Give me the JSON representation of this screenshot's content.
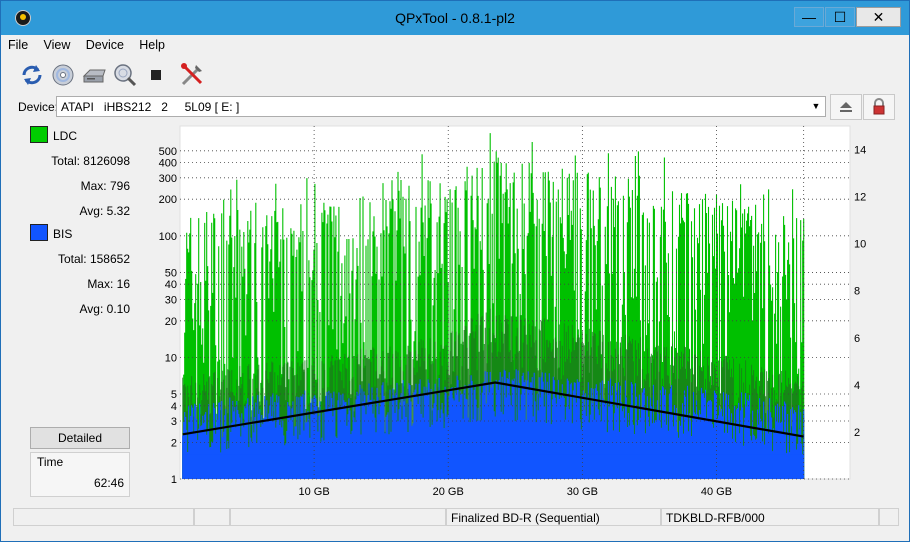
{
  "window": {
    "title": "QPxTool - 0.8.1-pl2",
    "min_glyph": "—",
    "max_glyph": "☐",
    "close_glyph": "✕"
  },
  "menu": [
    "File",
    "View",
    "Device",
    "Help"
  ],
  "toolbar": {
    "icons": [
      "refresh-icon",
      "disc-icon",
      "drive-icon",
      "scan-icon",
      "stop-icon",
      "tools-icon"
    ]
  },
  "device": {
    "label": "Device:",
    "value": "ATAPI   iHBS212   2     5L09 [ E: ]"
  },
  "ldc": {
    "name": "LDC",
    "color": "#00cc00",
    "total": "Total: 8126098",
    "max": "Max: 796",
    "avg": "Avg: 5.32"
  },
  "bis": {
    "name": "BIS",
    "color": "#1155ff",
    "total": "Total: 158652",
    "max": "Max: 16",
    "avg": "Avg: 0.10"
  },
  "detailed_label": "Detailed",
  "time": {
    "label": "Time",
    "value": "62:46"
  },
  "status": {
    "cells": [
      "",
      "",
      "",
      "Finalized BD-R (Sequential)",
      "TDKBLD-RFB/000",
      ""
    ]
  },
  "chart_data": {
    "type": "area",
    "y_left_scale": "log",
    "y_left_ticks": [
      "1",
      "2",
      "3",
      "4",
      "5",
      "10",
      "20",
      "30",
      "40",
      "50",
      "100",
      "200",
      "300",
      "400",
      "500"
    ],
    "y_right_ticks": [
      "2",
      "4",
      "6",
      "8",
      "10",
      "12",
      "14"
    ],
    "x_ticks": [
      "10 GB",
      "20 GB",
      "30 GB",
      "40 GB"
    ],
    "x_tick_values": [
      10,
      20,
      30,
      40
    ],
    "xlim": [
      0,
      46.6
    ],
    "ylim_left": [
      1,
      800
    ],
    "ylim_right": [
      0,
      15
    ],
    "grid": true,
    "series": [
      {
        "name": "LDC",
        "color": "#00c000",
        "note": "",
        "profile_x": [
          0.2,
          5,
          10,
          15,
          20,
          23.5,
          25,
          30,
          35,
          40,
          46.5
        ],
        "profile_y": [
          40,
          50,
          55,
          70,
          90,
          150,
          130,
          100,
          80,
          60,
          40
        ]
      },
      {
        "name": "BIS",
        "color": "#1155ff",
        "profile_x": [
          0.2,
          10,
          20,
          23.5,
          30,
          40,
          46.5
        ],
        "profile_y": [
          3,
          4,
          5,
          6,
          5,
          4,
          3
        ]
      },
      {
        "name": "Speed",
        "color": "#000000",
        "x": [
          0.2,
          23.5,
          46.5
        ],
        "y": [
          1.9,
          4.1,
          1.8
        ]
      }
    ]
  }
}
